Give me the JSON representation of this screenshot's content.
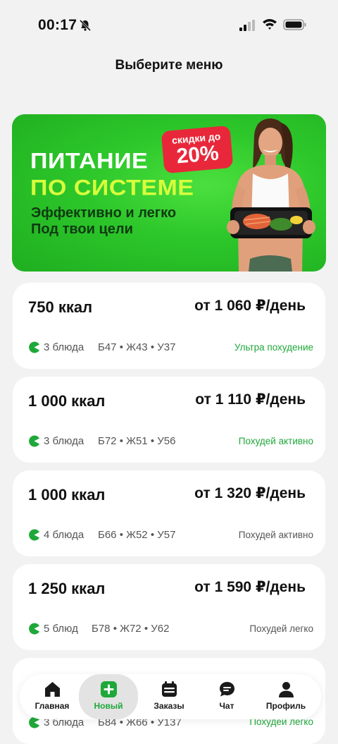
{
  "status": {
    "time": "00:17"
  },
  "title": "Выберите меню",
  "banner": {
    "line1": "ПИТАНИЕ",
    "line2": "ПО СИСТЕМЕ",
    "sub1": "Эффективно и легко",
    "sub2": "Под твои цели",
    "discount_small": "скидки до",
    "discount_big": "20%"
  },
  "plans": [
    {
      "kcal": "750 ккал",
      "price": "от 1 060 ₽/день",
      "dishes": "3 блюда",
      "macros": "Б47 • Ж43 • У37",
      "goal": "Ультра похудение",
      "goal_color": "#1fa83a"
    },
    {
      "kcal": "1 000 ккал",
      "price": "от 1 110 ₽/день",
      "dishes": "3 блюда",
      "macros": "Б72 • Ж51 • У56",
      "goal": "Похудей активно",
      "goal_color": "#1fa83a"
    },
    {
      "kcal": "1 000 ккал",
      "price": "от 1 320 ₽/день",
      "dishes": "4 блюда",
      "macros": "Б66 • Ж52 • У57",
      "goal": "Похудей активно",
      "goal_color": "#555555"
    },
    {
      "kcal": "1 250 ккал",
      "price": "от 1 590 ₽/день",
      "dishes": "5 блюд",
      "macros": "Б78 • Ж72 • У62",
      "goal": "Похудей легко",
      "goal_color": "#555555"
    },
    {
      "dishes": "3 блюда",
      "macros": "Б84 • Ж66 • У137",
      "goal": "Похудей легко",
      "goal_color": "#1fa83a"
    }
  ],
  "tabs": [
    {
      "label": "Главная",
      "icon": "home-icon"
    },
    {
      "label": "Новый",
      "icon": "plus-icon",
      "active": true
    },
    {
      "label": "Заказы",
      "icon": "calendar-icon"
    },
    {
      "label": "Чат",
      "icon": "chat-icon"
    },
    {
      "label": "Профиль",
      "icon": "profile-icon"
    }
  ],
  "colors": {
    "accent": "#1fa83a",
    "banner_green": "#2cc62a",
    "discount_red": "#e8283a"
  }
}
